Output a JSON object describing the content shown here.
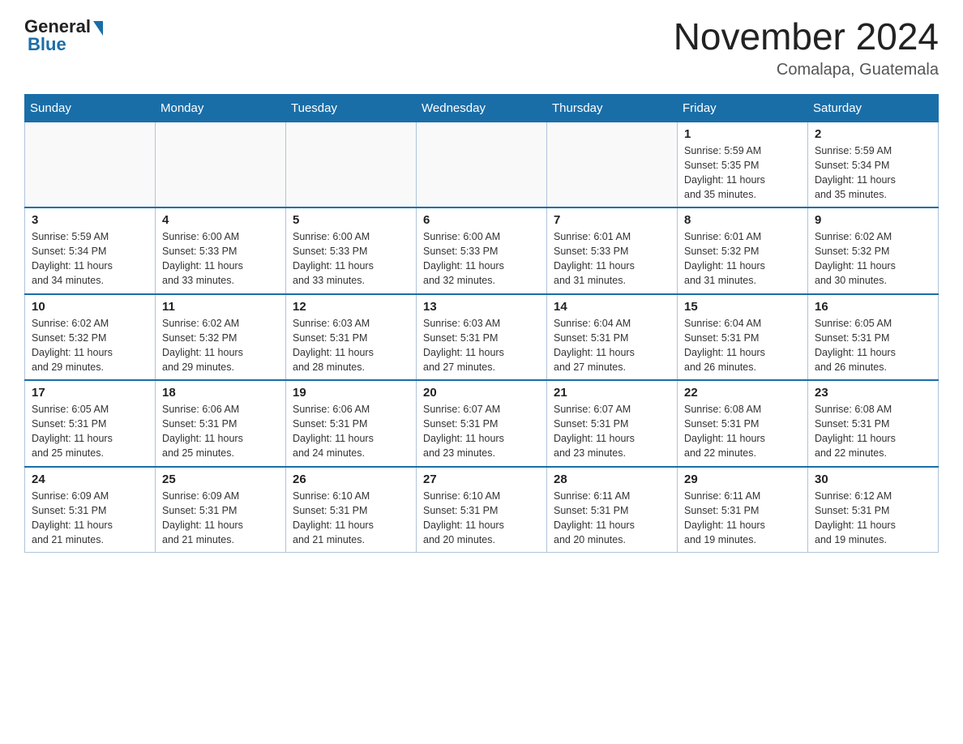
{
  "logo": {
    "general": "General",
    "blue": "Blue"
  },
  "title": {
    "month": "November 2024",
    "location": "Comalapa, Guatemala"
  },
  "weekdays": [
    "Sunday",
    "Monday",
    "Tuesday",
    "Wednesday",
    "Thursday",
    "Friday",
    "Saturday"
  ],
  "weeks": [
    [
      {
        "day": "",
        "info": ""
      },
      {
        "day": "",
        "info": ""
      },
      {
        "day": "",
        "info": ""
      },
      {
        "day": "",
        "info": ""
      },
      {
        "day": "",
        "info": ""
      },
      {
        "day": "1",
        "info": "Sunrise: 5:59 AM\nSunset: 5:35 PM\nDaylight: 11 hours\nand 35 minutes."
      },
      {
        "day": "2",
        "info": "Sunrise: 5:59 AM\nSunset: 5:34 PM\nDaylight: 11 hours\nand 35 minutes."
      }
    ],
    [
      {
        "day": "3",
        "info": "Sunrise: 5:59 AM\nSunset: 5:34 PM\nDaylight: 11 hours\nand 34 minutes."
      },
      {
        "day": "4",
        "info": "Sunrise: 6:00 AM\nSunset: 5:33 PM\nDaylight: 11 hours\nand 33 minutes."
      },
      {
        "day": "5",
        "info": "Sunrise: 6:00 AM\nSunset: 5:33 PM\nDaylight: 11 hours\nand 33 minutes."
      },
      {
        "day": "6",
        "info": "Sunrise: 6:00 AM\nSunset: 5:33 PM\nDaylight: 11 hours\nand 32 minutes."
      },
      {
        "day": "7",
        "info": "Sunrise: 6:01 AM\nSunset: 5:33 PM\nDaylight: 11 hours\nand 31 minutes."
      },
      {
        "day": "8",
        "info": "Sunrise: 6:01 AM\nSunset: 5:32 PM\nDaylight: 11 hours\nand 31 minutes."
      },
      {
        "day": "9",
        "info": "Sunrise: 6:02 AM\nSunset: 5:32 PM\nDaylight: 11 hours\nand 30 minutes."
      }
    ],
    [
      {
        "day": "10",
        "info": "Sunrise: 6:02 AM\nSunset: 5:32 PM\nDaylight: 11 hours\nand 29 minutes."
      },
      {
        "day": "11",
        "info": "Sunrise: 6:02 AM\nSunset: 5:32 PM\nDaylight: 11 hours\nand 29 minutes."
      },
      {
        "day": "12",
        "info": "Sunrise: 6:03 AM\nSunset: 5:31 PM\nDaylight: 11 hours\nand 28 minutes."
      },
      {
        "day": "13",
        "info": "Sunrise: 6:03 AM\nSunset: 5:31 PM\nDaylight: 11 hours\nand 27 minutes."
      },
      {
        "day": "14",
        "info": "Sunrise: 6:04 AM\nSunset: 5:31 PM\nDaylight: 11 hours\nand 27 minutes."
      },
      {
        "day": "15",
        "info": "Sunrise: 6:04 AM\nSunset: 5:31 PM\nDaylight: 11 hours\nand 26 minutes."
      },
      {
        "day": "16",
        "info": "Sunrise: 6:05 AM\nSunset: 5:31 PM\nDaylight: 11 hours\nand 26 minutes."
      }
    ],
    [
      {
        "day": "17",
        "info": "Sunrise: 6:05 AM\nSunset: 5:31 PM\nDaylight: 11 hours\nand 25 minutes."
      },
      {
        "day": "18",
        "info": "Sunrise: 6:06 AM\nSunset: 5:31 PM\nDaylight: 11 hours\nand 25 minutes."
      },
      {
        "day": "19",
        "info": "Sunrise: 6:06 AM\nSunset: 5:31 PM\nDaylight: 11 hours\nand 24 minutes."
      },
      {
        "day": "20",
        "info": "Sunrise: 6:07 AM\nSunset: 5:31 PM\nDaylight: 11 hours\nand 23 minutes."
      },
      {
        "day": "21",
        "info": "Sunrise: 6:07 AM\nSunset: 5:31 PM\nDaylight: 11 hours\nand 23 minutes."
      },
      {
        "day": "22",
        "info": "Sunrise: 6:08 AM\nSunset: 5:31 PM\nDaylight: 11 hours\nand 22 minutes."
      },
      {
        "day": "23",
        "info": "Sunrise: 6:08 AM\nSunset: 5:31 PM\nDaylight: 11 hours\nand 22 minutes."
      }
    ],
    [
      {
        "day": "24",
        "info": "Sunrise: 6:09 AM\nSunset: 5:31 PM\nDaylight: 11 hours\nand 21 minutes."
      },
      {
        "day": "25",
        "info": "Sunrise: 6:09 AM\nSunset: 5:31 PM\nDaylight: 11 hours\nand 21 minutes."
      },
      {
        "day": "26",
        "info": "Sunrise: 6:10 AM\nSunset: 5:31 PM\nDaylight: 11 hours\nand 21 minutes."
      },
      {
        "day": "27",
        "info": "Sunrise: 6:10 AM\nSunset: 5:31 PM\nDaylight: 11 hours\nand 20 minutes."
      },
      {
        "day": "28",
        "info": "Sunrise: 6:11 AM\nSunset: 5:31 PM\nDaylight: 11 hours\nand 20 minutes."
      },
      {
        "day": "29",
        "info": "Sunrise: 6:11 AM\nSunset: 5:31 PM\nDaylight: 11 hours\nand 19 minutes."
      },
      {
        "day": "30",
        "info": "Sunrise: 6:12 AM\nSunset: 5:31 PM\nDaylight: 11 hours\nand 19 minutes."
      }
    ]
  ]
}
